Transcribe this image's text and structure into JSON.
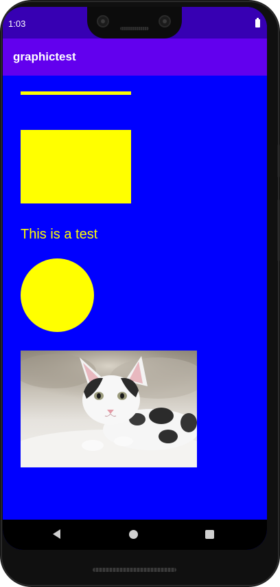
{
  "status_bar": {
    "time": "1:03",
    "battery_icon": "battery-full-icon"
  },
  "app_bar": {
    "title": "graphictest"
  },
  "canvas": {
    "background_color": "#0000ff",
    "shape_color": "#ffff00",
    "line": {
      "shape": "horizontal-line"
    },
    "rectangle": {
      "shape": "filled-rectangle"
    },
    "text": "This is a test",
    "circle": {
      "shape": "filled-circle"
    },
    "image": {
      "subject": "white-and-black-kitten"
    }
  },
  "colors": {
    "status_bar": "#3700b3",
    "app_bar": "#6200ee",
    "nav_bar": "#000000"
  },
  "nav_bar": {
    "back_icon": "back-triangle-icon",
    "home_icon": "home-circle-icon",
    "recents_icon": "recents-square-icon"
  }
}
